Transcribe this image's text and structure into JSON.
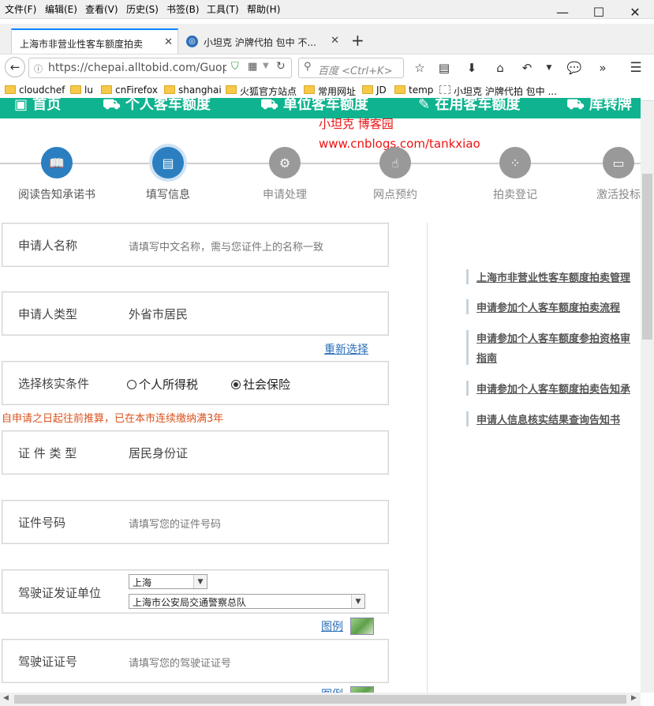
{
  "menubar": {
    "items": [
      "文件(F)",
      "编辑(E)",
      "查看(V)",
      "历史(S)",
      "书签(B)",
      "工具(T)",
      "帮助(H)"
    ]
  },
  "window_controls": {
    "minimize": "—",
    "maximize": "☐",
    "close": "✕"
  },
  "tabs": [
    {
      "title": "上海市非营业性客车额度拍卖",
      "active": true
    },
    {
      "title": "小坦克 沪牌代拍 包中 不...",
      "active": false
    }
  ],
  "navbar": {
    "url": "https://chepai.alltobid.com/Guop",
    "search_placeholder": "百度 <Ctrl+K>"
  },
  "bookmarks": [
    "cloudchef",
    "lu",
    "cnFirefox",
    "shanghai",
    "火狐官方站点",
    "常用网址",
    "JD",
    "temp",
    "小坦克 沪牌代拍 包中 ..."
  ],
  "banner": {
    "items": [
      "首页",
      "个人客车额度",
      "单位客车额度",
      "在用客车额度",
      "库转牌"
    ]
  },
  "watermark": {
    "line1": "小坦克 博客园",
    "line2": "www.cnblogs.com/tankxiao"
  },
  "steps": [
    {
      "label": "阅读告知承诺书",
      "icon": "book-icon",
      "state": "done"
    },
    {
      "label": "填写信息",
      "icon": "form-icon",
      "state": "current"
    },
    {
      "label": "申请处理",
      "icon": "processing-icon",
      "state": "todo"
    },
    {
      "label": "网点预约",
      "icon": "tap-icon",
      "state": "todo"
    },
    {
      "label": "拍卖登记",
      "icon": "dots-icon",
      "state": "todo"
    },
    {
      "label": "激活投标",
      "icon": "card-icon",
      "state": "todo"
    }
  ],
  "form": {
    "applicant_name": {
      "label": "申请人名称",
      "placeholder": "请填写中文名称，需与您证件上的名称一致"
    },
    "applicant_type": {
      "label": "申请人类型",
      "value": "外省市居民",
      "reselect": "重新选择"
    },
    "verify_condition": {
      "label": "选择核实条件",
      "option1": "个人所得税",
      "option2": "社会保险",
      "selected": "社会保险"
    },
    "verify_note": "自申请之日起往前推算，已在本市连续缴纳满3年",
    "id_type": {
      "label": "证 件 类 型",
      "value": "居民身份证"
    },
    "id_number": {
      "label": "证件号码",
      "placeholder": "请填写您的证件号码"
    },
    "license_issuer": {
      "label": "驾驶证发证单位",
      "city": "上海",
      "unit": "上海市公安局交通警察总队",
      "example": "图例"
    },
    "license_number": {
      "label": "驾驶证证号",
      "placeholder": "请填写您的驾驶证证号",
      "example": "图例"
    }
  },
  "sidebar": {
    "links": [
      "上海市非营业性客车额度拍卖管理",
      "申请参加个人客车额度拍卖流程",
      "申请参加个人客车额度参拍资格审",
      "指南",
      "申请参加个人客车额度拍卖告知承",
      "申请人信息核实结果查询告知书"
    ]
  },
  "colors": {
    "accent": "#2b7fc0",
    "banner": "#0fb38f",
    "note": "#d9531e",
    "watermark": "#e11111"
  }
}
